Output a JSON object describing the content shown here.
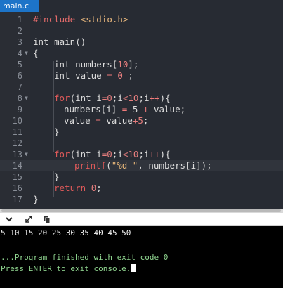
{
  "tab": {
    "label": "main.c"
  },
  "editor": {
    "lines": [
      {
        "num": "1",
        "fold": ""
      },
      {
        "num": "2",
        "fold": ""
      },
      {
        "num": "3",
        "fold": ""
      },
      {
        "num": "4",
        "fold": "▼"
      },
      {
        "num": "5",
        "fold": ""
      },
      {
        "num": "6",
        "fold": ""
      },
      {
        "num": "7",
        "fold": ""
      },
      {
        "num": "8",
        "fold": "▼"
      },
      {
        "num": "9",
        "fold": ""
      },
      {
        "num": "10",
        "fold": ""
      },
      {
        "num": "11",
        "fold": ""
      },
      {
        "num": "12",
        "fold": ""
      },
      {
        "num": "13",
        "fold": "▼"
      },
      {
        "num": "14",
        "fold": ""
      },
      {
        "num": "15",
        "fold": ""
      },
      {
        "num": "16",
        "fold": ""
      },
      {
        "num": "17",
        "fold": ""
      }
    ],
    "code": {
      "l1_pre": "#include ",
      "l1_hdr": "<stdio.h>",
      "l3": "int main()",
      "l4": "{",
      "l5_a": "int numbers[",
      "l5_b": "10",
      "l5_c": "];",
      "l6_a": "int value ",
      "l6_b": "=",
      "l6_c": " ",
      "l6_d": "0",
      "l6_e": " ;",
      "l8_a": "for",
      "l8_b": "(int i",
      "l8_c": "=0",
      "l8_d": ";i",
      "l8_e": "<10",
      "l8_f": ";i",
      "l8_g": "++",
      "l8_h": "){",
      "l9_a": "numbers[i] ",
      "l9_b": "=",
      "l9_c": " 5 ",
      "l9_d": "+",
      "l9_e": " value;",
      "l10_a": "value ",
      "l10_b": "=",
      "l10_c": " value",
      "l10_d": "+5",
      "l10_e": ";",
      "l11": "}",
      "l13_a": "for",
      "l13_b": "(int i",
      "l13_c": "=0",
      "l13_d": ";i",
      "l13_e": "<10",
      "l13_f": ";i",
      "l13_g": "++",
      "l13_h": "){",
      "l14_a": "printf",
      "l14_b": "(",
      "l14_c": "\"%d \"",
      "l14_d": ", numbers[i]);",
      "l15": "}",
      "l16_a": "return ",
      "l16_b": "0",
      "l16_c": ";",
      "l17": "}"
    }
  },
  "console": {
    "output_line": "5 10 15 20 25 30 35 40 45 50",
    "status_line": "...Program finished with exit code 0",
    "prompt_line": "Press ENTER to exit console."
  },
  "colors": {
    "editor_bg": "#272b33",
    "tab_active": "#1d74c8",
    "keyword_red": "#e05a5a",
    "string_orange": "#e9b87a",
    "console_green": "#8fd48f"
  }
}
